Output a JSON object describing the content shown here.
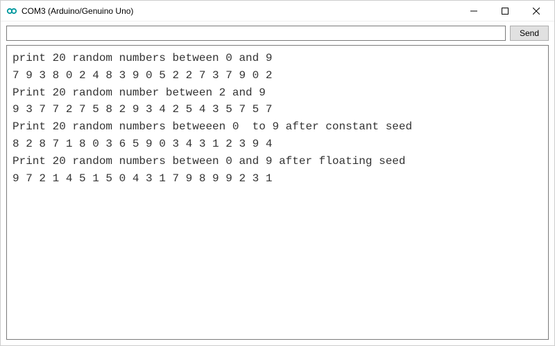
{
  "window": {
    "title": "COM3 (Arduino/Genuino Uno)"
  },
  "toolbar": {
    "input_value": "",
    "input_placeholder": "",
    "send_label": "Send"
  },
  "console": {
    "lines": [
      "print 20 random numbers between 0 and 9",
      "7 9 3 8 0 2 4 8 3 9 0 5 2 2 7 3 7 9 0 2 ",
      "Print 20 random number between 2 and 9",
      "9 3 7 7 2 7 5 8 2 9 3 4 2 5 4 3 5 7 5 7 ",
      "Print 20 random numbers betweeen 0  to 9 after constant seed",
      "8 2 8 7 1 8 0 3 6 5 9 0 3 4 3 1 2 3 9 4 ",
      "Print 20 random numbers between 0 and 9 after floating seed",
      "9 7 2 1 4 5 1 5 0 4 3 1 7 9 8 9 9 2 3 1 "
    ]
  }
}
